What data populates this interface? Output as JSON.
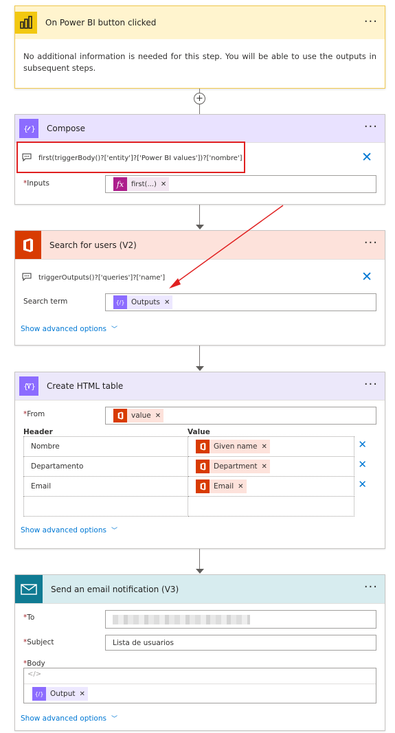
{
  "trigger": {
    "title": "On Power BI button clicked",
    "description": "No additional information is needed for this step. You will be able to use the outputs in subsequent steps.",
    "color": "#fff4ce"
  },
  "add_step_symbol": "+",
  "compose": {
    "title": "Compose",
    "expression": "first(triggerBody()?['entity']?['Power BI values'])?['nombre']",
    "inputs_label": "Inputs",
    "inputs_token": "first(...)",
    "color": "#e9e2ff"
  },
  "search_users": {
    "title": "Search for users (V2)",
    "expression": "triggerOutputs()?['queries']?['name']",
    "search_term_label": "Search term",
    "search_term_token": "Outputs",
    "advanced_label": "Show advanced options",
    "color": "#fde2db"
  },
  "html_table": {
    "title": "Create HTML table",
    "from_label": "From",
    "from_token": "value",
    "header_col": "Header",
    "value_col": "Value",
    "rows": [
      {
        "header": "Nombre",
        "value": "Given name"
      },
      {
        "header": "Departamento",
        "value": "Department"
      },
      {
        "header": "Email",
        "value": "Email"
      }
    ],
    "advanced_label": "Show advanced options",
    "color": "#ece8fa"
  },
  "email": {
    "title": "Send an email notification (V3)",
    "to_label": "To",
    "subject_label": "Subject",
    "subject_value": "Lista de usuarios",
    "body_label": "Body",
    "body_token": "Output",
    "advanced_label": "Show advanced options",
    "color": "#d7ecef"
  },
  "icons": {
    "menu": "ellipsis-icon",
    "close": "close-icon",
    "chevron": "chevron-down-icon"
  },
  "colors": {
    "accent": "#0078d4",
    "annotation": "#e02020",
    "office": "#d83b01",
    "variable": "#8c6cff",
    "expression": "#ad1d8c",
    "mail": "#0f7b93"
  }
}
